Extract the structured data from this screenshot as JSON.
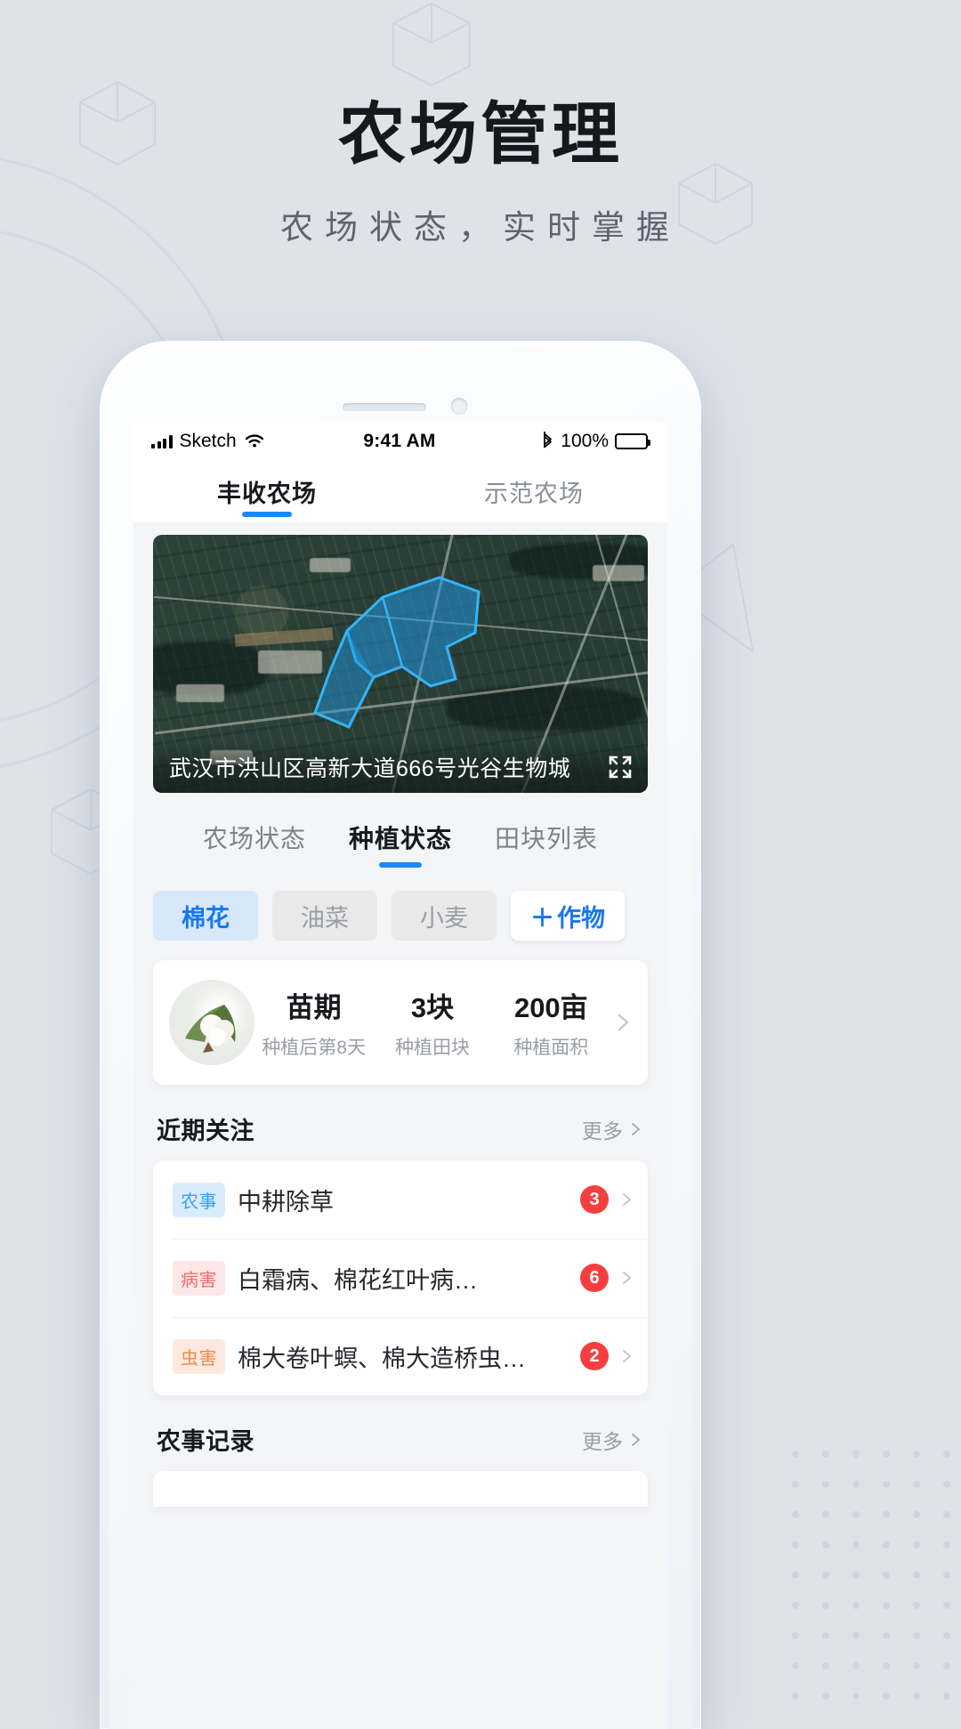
{
  "hero": {
    "title": "农场管理",
    "subtitle": "农场状态，实时掌握"
  },
  "status_bar": {
    "carrier": "Sketch",
    "signal_icon": "signal-bars-icon",
    "wifi_icon": "wifi-icon",
    "time": "9:41 AM",
    "bluetooth_icon": "bluetooth-icon",
    "battery_percent": "100%",
    "battery_icon": "battery-full-icon"
  },
  "farm_tabs": [
    {
      "label": "丰收农场",
      "active": true
    },
    {
      "label": "示范农场",
      "active": false
    }
  ],
  "map": {
    "address": "武汉市洪山区高新大道666号光谷生物城",
    "expand_icon": "expand-fullscreen-icon",
    "parcel_color": "#1e9ae8"
  },
  "inner_tabs": [
    {
      "label": "农场状态",
      "active": false
    },
    {
      "label": "种植状态",
      "active": true
    },
    {
      "label": "田块列表",
      "active": false
    }
  ],
  "crop_chips": [
    {
      "label": "棉花",
      "active": true
    },
    {
      "label": "油菜",
      "active": false
    },
    {
      "label": "小麦",
      "active": false
    }
  ],
  "add_crop": {
    "plus": "＋",
    "label": "作物"
  },
  "stat_card": {
    "thumb_icon": "cotton-boll-image",
    "chevron_icon": "chevron-right-icon",
    "stats": [
      {
        "value": "苗期",
        "label": "种植后第8天"
      },
      {
        "value": "3块",
        "label": "种植田块"
      },
      {
        "value": "200亩",
        "label": "种植面积"
      }
    ]
  },
  "recent_section": {
    "title": "近期关注",
    "more_label": "更多",
    "more_icon": "chevron-right-icon",
    "items": [
      {
        "tag": "农事",
        "tag_style": "t-blue",
        "title": "中耕除草",
        "badge": "3",
        "chevron_icon": "chevron-right-icon"
      },
      {
        "tag": "病害",
        "tag_style": "t-pink",
        "title": "白霜病、棉花红叶病…",
        "badge": "6",
        "chevron_icon": "chevron-right-icon"
      },
      {
        "tag": "虫害",
        "tag_style": "t-orange",
        "title": "棉大卷叶螟、棉大造桥虫…",
        "badge": "2",
        "chevron_icon": "chevron-right-icon"
      }
    ]
  },
  "records_section": {
    "title": "农事记录",
    "more_label": "更多",
    "more_icon": "chevron-right-icon"
  },
  "colors": {
    "page_bg": "#dee3ea",
    "accent": "#1989fa",
    "badge_red": "#f53f3f",
    "chip_active_bg": "#d9e7fb",
    "chip_active_text": "#1777f0"
  }
}
